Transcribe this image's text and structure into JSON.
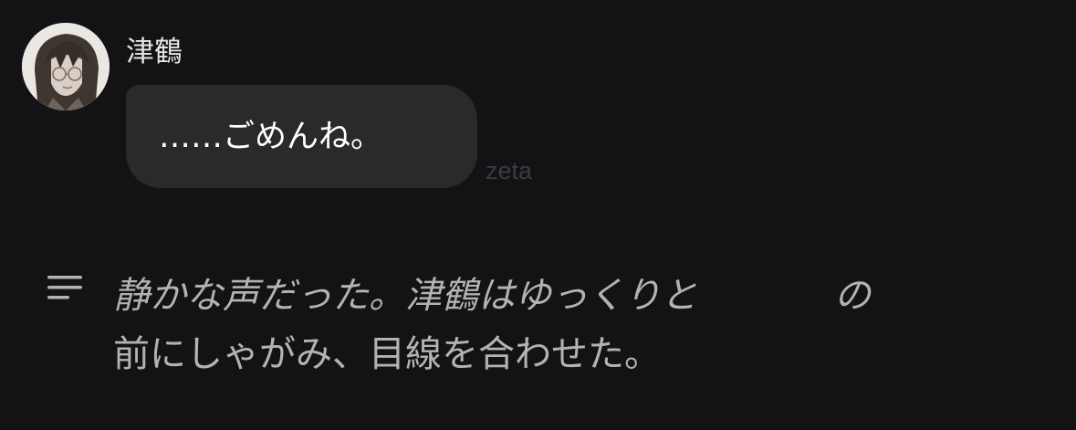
{
  "message": {
    "sender_name": "津鶴",
    "avatar": "character-portrait",
    "text": "……ごめんね。",
    "watermark": "zeta"
  },
  "narration": {
    "icon": "lines-icon",
    "line1_part1": "静かな声だった。津鶴はゆっくりと",
    "line1_part2": "の",
    "line2": "前にしゃがみ、目線を合わせた。"
  }
}
